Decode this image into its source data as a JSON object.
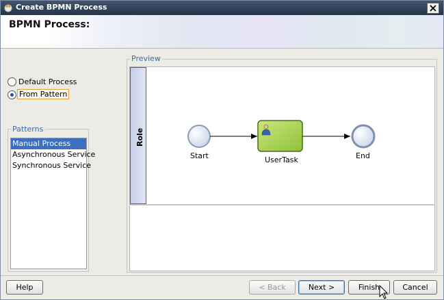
{
  "window": {
    "title": "Create BPMN Process",
    "banner_title": "BPMN Process:"
  },
  "options": {
    "default_process": "Default Process",
    "from_pattern": "From Pattern",
    "selected": "from_pattern"
  },
  "patterns": {
    "label": "Patterns",
    "items": [
      "Manual Process",
      "Asynchronous Service",
      "Synchronous Service"
    ],
    "selected_index": 0
  },
  "preview": {
    "label": "Preview",
    "lane_label": "Role",
    "nodes": {
      "start": "Start",
      "task": "UserTask",
      "end": "End"
    }
  },
  "buttons": {
    "help": "Help",
    "back": "< Back",
    "next": "Next >",
    "finish": "Finish",
    "cancel": "Cancel"
  },
  "colors": {
    "accent": "#3d6ec0",
    "task_fill": "#9ccd3c",
    "event_fill": "#dfe8f5"
  }
}
